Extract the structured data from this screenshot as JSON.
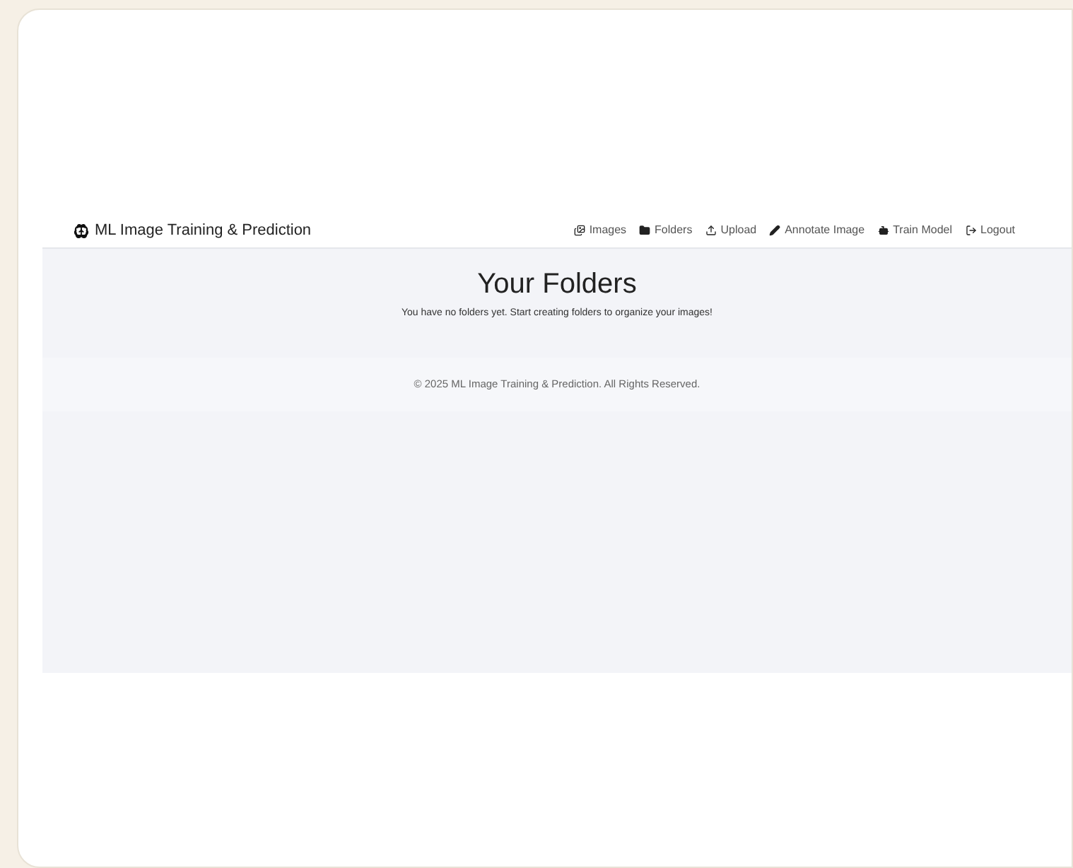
{
  "navbar": {
    "brand": "ML Image Training & Prediction",
    "links": [
      {
        "kind": "images",
        "label": "Images"
      },
      {
        "kind": "folders",
        "label": "Folders"
      },
      {
        "kind": "upload",
        "label": "Upload"
      },
      {
        "kind": "annotate",
        "label": "Annotate Image"
      },
      {
        "kind": "train",
        "label": "Train Model"
      },
      {
        "kind": "logout",
        "label": "Logout"
      }
    ]
  },
  "main": {
    "title": "Your Folders",
    "message": "You have no folders yet. Start creating folders to organize your images!"
  },
  "footer": {
    "text": "© 2025 ML Image Training & Prediction. All Rights Reserved."
  }
}
